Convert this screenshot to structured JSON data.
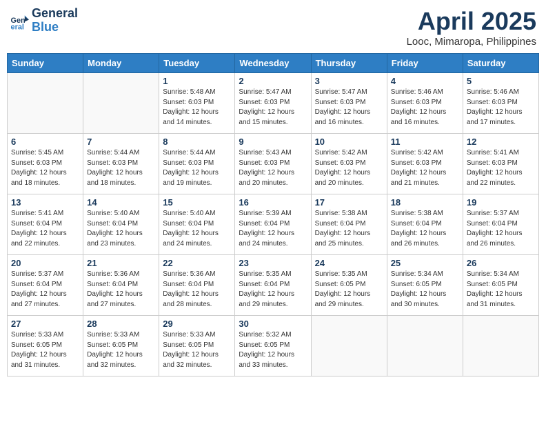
{
  "header": {
    "logo_line1": "General",
    "logo_line2": "Blue",
    "title": "April 2025",
    "subtitle": "Looc, Mimaropa, Philippines"
  },
  "weekdays": [
    "Sunday",
    "Monday",
    "Tuesday",
    "Wednesday",
    "Thursday",
    "Friday",
    "Saturday"
  ],
  "weeks": [
    [
      {
        "day": "",
        "info": ""
      },
      {
        "day": "",
        "info": ""
      },
      {
        "day": "1",
        "info": "Sunrise: 5:48 AM\nSunset: 6:03 PM\nDaylight: 12 hours\nand 14 minutes."
      },
      {
        "day": "2",
        "info": "Sunrise: 5:47 AM\nSunset: 6:03 PM\nDaylight: 12 hours\nand 15 minutes."
      },
      {
        "day": "3",
        "info": "Sunrise: 5:47 AM\nSunset: 6:03 PM\nDaylight: 12 hours\nand 16 minutes."
      },
      {
        "day": "4",
        "info": "Sunrise: 5:46 AM\nSunset: 6:03 PM\nDaylight: 12 hours\nand 16 minutes."
      },
      {
        "day": "5",
        "info": "Sunrise: 5:46 AM\nSunset: 6:03 PM\nDaylight: 12 hours\nand 17 minutes."
      }
    ],
    [
      {
        "day": "6",
        "info": "Sunrise: 5:45 AM\nSunset: 6:03 PM\nDaylight: 12 hours\nand 18 minutes."
      },
      {
        "day": "7",
        "info": "Sunrise: 5:44 AM\nSunset: 6:03 PM\nDaylight: 12 hours\nand 18 minutes."
      },
      {
        "day": "8",
        "info": "Sunrise: 5:44 AM\nSunset: 6:03 PM\nDaylight: 12 hours\nand 19 minutes."
      },
      {
        "day": "9",
        "info": "Sunrise: 5:43 AM\nSunset: 6:03 PM\nDaylight: 12 hours\nand 20 minutes."
      },
      {
        "day": "10",
        "info": "Sunrise: 5:42 AM\nSunset: 6:03 PM\nDaylight: 12 hours\nand 20 minutes."
      },
      {
        "day": "11",
        "info": "Sunrise: 5:42 AM\nSunset: 6:03 PM\nDaylight: 12 hours\nand 21 minutes."
      },
      {
        "day": "12",
        "info": "Sunrise: 5:41 AM\nSunset: 6:03 PM\nDaylight: 12 hours\nand 22 minutes."
      }
    ],
    [
      {
        "day": "13",
        "info": "Sunrise: 5:41 AM\nSunset: 6:04 PM\nDaylight: 12 hours\nand 22 minutes."
      },
      {
        "day": "14",
        "info": "Sunrise: 5:40 AM\nSunset: 6:04 PM\nDaylight: 12 hours\nand 23 minutes."
      },
      {
        "day": "15",
        "info": "Sunrise: 5:40 AM\nSunset: 6:04 PM\nDaylight: 12 hours\nand 24 minutes."
      },
      {
        "day": "16",
        "info": "Sunrise: 5:39 AM\nSunset: 6:04 PM\nDaylight: 12 hours\nand 24 minutes."
      },
      {
        "day": "17",
        "info": "Sunrise: 5:38 AM\nSunset: 6:04 PM\nDaylight: 12 hours\nand 25 minutes."
      },
      {
        "day": "18",
        "info": "Sunrise: 5:38 AM\nSunset: 6:04 PM\nDaylight: 12 hours\nand 26 minutes."
      },
      {
        "day": "19",
        "info": "Sunrise: 5:37 AM\nSunset: 6:04 PM\nDaylight: 12 hours\nand 26 minutes."
      }
    ],
    [
      {
        "day": "20",
        "info": "Sunrise: 5:37 AM\nSunset: 6:04 PM\nDaylight: 12 hours\nand 27 minutes."
      },
      {
        "day": "21",
        "info": "Sunrise: 5:36 AM\nSunset: 6:04 PM\nDaylight: 12 hours\nand 27 minutes."
      },
      {
        "day": "22",
        "info": "Sunrise: 5:36 AM\nSunset: 6:04 PM\nDaylight: 12 hours\nand 28 minutes."
      },
      {
        "day": "23",
        "info": "Sunrise: 5:35 AM\nSunset: 6:04 PM\nDaylight: 12 hours\nand 29 minutes."
      },
      {
        "day": "24",
        "info": "Sunrise: 5:35 AM\nSunset: 6:05 PM\nDaylight: 12 hours\nand 29 minutes."
      },
      {
        "day": "25",
        "info": "Sunrise: 5:34 AM\nSunset: 6:05 PM\nDaylight: 12 hours\nand 30 minutes."
      },
      {
        "day": "26",
        "info": "Sunrise: 5:34 AM\nSunset: 6:05 PM\nDaylight: 12 hours\nand 31 minutes."
      }
    ],
    [
      {
        "day": "27",
        "info": "Sunrise: 5:33 AM\nSunset: 6:05 PM\nDaylight: 12 hours\nand 31 minutes."
      },
      {
        "day": "28",
        "info": "Sunrise: 5:33 AM\nSunset: 6:05 PM\nDaylight: 12 hours\nand 32 minutes."
      },
      {
        "day": "29",
        "info": "Sunrise: 5:33 AM\nSunset: 6:05 PM\nDaylight: 12 hours\nand 32 minutes."
      },
      {
        "day": "30",
        "info": "Sunrise: 5:32 AM\nSunset: 6:05 PM\nDaylight: 12 hours\nand 33 minutes."
      },
      {
        "day": "",
        "info": ""
      },
      {
        "day": "",
        "info": ""
      },
      {
        "day": "",
        "info": ""
      }
    ]
  ]
}
